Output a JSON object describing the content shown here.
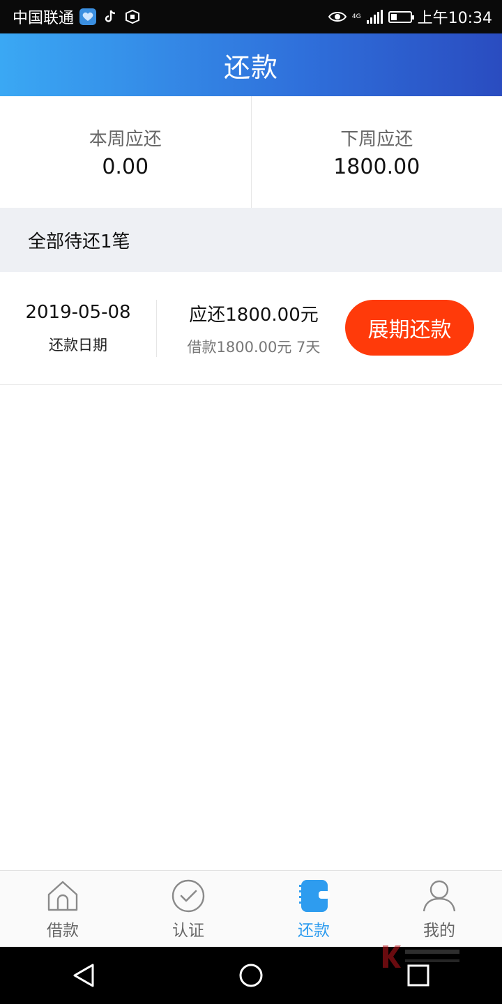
{
  "status_bar": {
    "carrier": "中国联通",
    "network": "4G",
    "time": "上午10:34",
    "battery_level": 0.3,
    "icons": [
      "app-badge-icon",
      "tiktok-icon",
      "shield-app-icon",
      "eye-icon",
      "signal-icon",
      "battery-icon"
    ]
  },
  "header": {
    "title": "还款"
  },
  "summary": {
    "this_week": {
      "label": "本周应还",
      "value": "0.00"
    },
    "next_week": {
      "label": "下周应还",
      "value": "1800.00"
    }
  },
  "pending": {
    "text": "全部待还1笔"
  },
  "bill": {
    "date": "2019-05-08",
    "date_label": "还款日期",
    "due": "应还1800.00元",
    "borrowed": "借款1800.00元 7天",
    "extend_label": "展期还款"
  },
  "bottom_nav": {
    "items": [
      {
        "label": "借款",
        "icon": "home-icon",
        "active": false
      },
      {
        "label": "认证",
        "icon": "check-circle-icon",
        "active": false
      },
      {
        "label": "还款",
        "icon": "wallet-icon",
        "active": true
      },
      {
        "label": "我的",
        "icon": "user-icon",
        "active": false
      }
    ]
  },
  "colors": {
    "header_gradient_start": "#3aa8f4",
    "header_gradient_end": "#2a4cc0",
    "accent_button": "#ff3a0a",
    "nav_active": "#2e9cef",
    "nav_inactive": "#666666"
  }
}
